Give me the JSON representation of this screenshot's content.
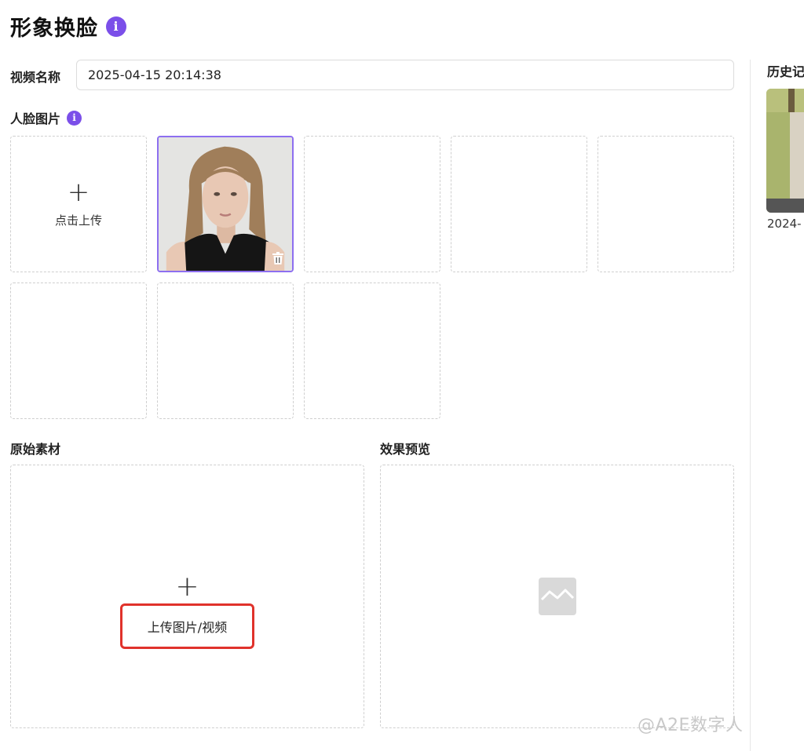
{
  "header": {
    "title": "形象换脸",
    "info_icon": "i"
  },
  "form": {
    "video_name_label": "视频名称",
    "video_name_value": "2025-04-15 20:14:38",
    "face_label": "人脸图片",
    "face_info_icon": "i",
    "upload_label": "点击上传"
  },
  "source": {
    "label": "原始素材",
    "upload_label": "上传图片/视频"
  },
  "preview": {
    "label": "效果预览"
  },
  "history": {
    "label": "历史记",
    "date": "2024-"
  },
  "watermark": "@A2E数字人",
  "colors": {
    "accent": "#7b4fe9",
    "highlight": "#e0322b"
  }
}
